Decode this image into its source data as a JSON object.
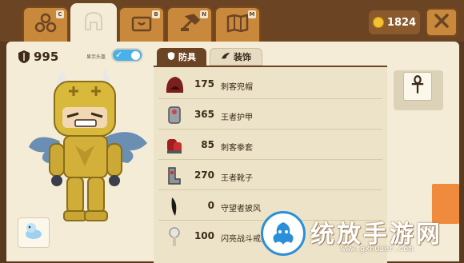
{
  "tabs": [
    {
      "name": "team-tab",
      "key": "C",
      "icon": "group-icon"
    },
    {
      "name": "equipment-tab",
      "key": "",
      "icon": "helmet-icon",
      "active": true
    },
    {
      "name": "chest-tab",
      "key": "B",
      "icon": "chest-icon"
    },
    {
      "name": "forge-tab",
      "key": "N",
      "icon": "hammer-icon"
    },
    {
      "name": "book-tab",
      "key": "M",
      "icon": "map-book-icon"
    }
  ],
  "coins": "1824",
  "character": {
    "power": "995",
    "hat_toggle_label": "显示头盔",
    "hat_toggle_on": true
  },
  "subtabs": {
    "armor": "防具",
    "decoration": "装饰"
  },
  "equipment": [
    {
      "value": "175",
      "name": "刺客兜帽",
      "icon": "hood-icon"
    },
    {
      "value": "365",
      "name": "王者护甲",
      "icon": "armor-icon"
    },
    {
      "value": "85",
      "name": "刺客拳套",
      "icon": "gauntlet-icon"
    },
    {
      "value": "270",
      "name": "王者靴子",
      "icon": "boots-icon"
    },
    {
      "value": "0",
      "name": "守望者披风",
      "icon": "cape-icon"
    },
    {
      "value": "100",
      "name": "闪亮战斗戒指",
      "icon": "ring-icon"
    }
  ],
  "watermark": {
    "text": "统放手游网",
    "url": "www.gxhuaer.com"
  },
  "colors": {
    "accent": "#4ab0e8",
    "panel": "#f4ecd6",
    "frame": "#6b4424",
    "coin": "#f3c230"
  }
}
